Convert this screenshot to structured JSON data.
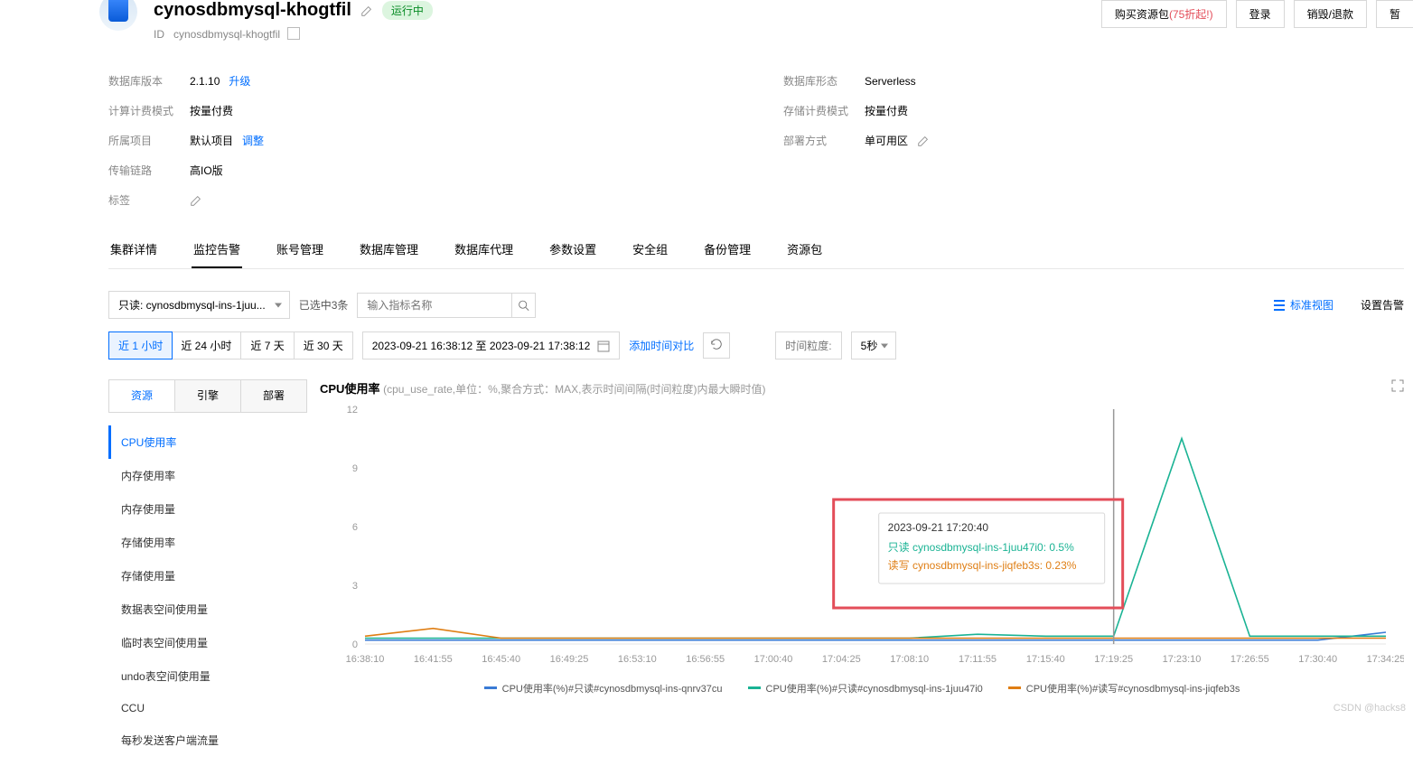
{
  "header": {
    "title": "cynosdbmysql-khogtfil",
    "status_badge": "运行中",
    "id_label": "ID",
    "id_value": "cynosdbmysql-khogtfil",
    "actions": {
      "buy_prefix": "购买资源包",
      "buy_promo": "(75折起!)",
      "login": "登录",
      "destroy": "销毁/退款",
      "pause": "暂"
    }
  },
  "info_left": [
    {
      "label": "数据库版本",
      "value": "2.1.10",
      "link": "升级"
    },
    {
      "label": "计算计费模式",
      "value": "按量付费"
    },
    {
      "label": "所属项目",
      "value": "默认项目",
      "link": "调整"
    },
    {
      "label": "传输链路",
      "value": "高IO版"
    },
    {
      "label": "标签",
      "value": "",
      "pen": true
    }
  ],
  "info_right": [
    {
      "label": "数据库形态",
      "value": "Serverless"
    },
    {
      "label": "存储计费模式",
      "value": "按量付费"
    },
    {
      "label": "部署方式",
      "value": "单可用区",
      "pen": true
    }
  ],
  "tabs": [
    "集群详情",
    "监控告警",
    "账号管理",
    "数据库管理",
    "数据库代理",
    "参数设置",
    "安全组",
    "备份管理",
    "资源包"
  ],
  "tab_active": 1,
  "toolbar": {
    "instance_select": "只读: cynosdbmysql-ins-1juu...",
    "selected_count": "已选中3条",
    "search_placeholder": "输入指标名称",
    "standard_view": "标准视图",
    "set_alarm": "设置告警"
  },
  "timebar": {
    "ranges": [
      "近 1 小时",
      "近 24 小时",
      "近 7 天",
      "近 30 天"
    ],
    "range_active": 0,
    "datetime_range": "2023-09-21 16:38:12 至 2023-09-21 17:38:12",
    "add_compare": "添加时间对比",
    "granularity_label": "时间粒度:",
    "granularity_value": "5秒"
  },
  "metric_panel": {
    "tabs": [
      "资源",
      "引擎",
      "部署"
    ],
    "tab_active": 0,
    "items": [
      "CPU使用率",
      "内存使用率",
      "内存使用量",
      "存储使用率",
      "存储使用量",
      "数据表空间使用量",
      "临时表空间使用量",
      "undo表空间使用量",
      "CCU",
      "每秒发送客户端流量"
    ],
    "item_active": 0
  },
  "chart": {
    "title": "CPU使用率",
    "desc": "(cpu_use_rate,单位：%,聚合方式：MAX,表示时间间隔(时间粒度)内最大瞬时值)",
    "tooltip": {
      "time": "2023-09-21 17:20:40",
      "rows": [
        {
          "color": "#1ab394",
          "text": "只读 cynosdbmysql-ins-1juu47i0: 0.5%"
        },
        {
          "color": "#df7e14",
          "text": "读写 cynosdbmysql-ins-jiqfeb3s: 0.23%"
        }
      ]
    },
    "legend": [
      {
        "color": "#3a7bd5",
        "text": "CPU使用率(%)#只读#cynosdbmysql-ins-qnrv37cu"
      },
      {
        "color": "#1ab394",
        "text": "CPU使用率(%)#只读#cynosdbmysql-ins-1juu47i0"
      },
      {
        "color": "#df7e14",
        "text": "CPU使用率(%)#读写#cynosdbmysql-ins-jiqfeb3s"
      }
    ]
  },
  "chart_data": {
    "type": "line",
    "title": "CPU使用率",
    "ylabel": "%",
    "ylim": [
      0,
      12
    ],
    "yticks": [
      0,
      3,
      6,
      9,
      12
    ],
    "x_labels": [
      "16:38:10",
      "16:41:55",
      "16:45:40",
      "16:49:25",
      "16:53:10",
      "16:56:55",
      "17:00:40",
      "17:04:25",
      "17:08:10",
      "17:11:55",
      "17:15:40",
      "17:19:25",
      "17:23:10",
      "17:26:55",
      "17:30:40",
      "17:34:25"
    ],
    "series": [
      {
        "name": "只读 qnrv37cu",
        "color": "#3a7bd5",
        "values": [
          0.2,
          0.2,
          0.2,
          0.2,
          0.2,
          0.2,
          0.2,
          0.2,
          0.2,
          0.2,
          0.2,
          0.2,
          0.2,
          0.2,
          0.2,
          0.6
        ]
      },
      {
        "name": "只读 1juu47i0",
        "color": "#1ab394",
        "values": [
          0.3,
          0.3,
          0.3,
          0.3,
          0.3,
          0.3,
          0.3,
          0.3,
          0.3,
          0.5,
          0.4,
          0.4,
          10.5,
          0.4,
          0.4,
          0.4
        ]
      },
      {
        "name": "读写 jiqfeb3s",
        "color": "#df7e14",
        "values": [
          0.4,
          0.8,
          0.3,
          0.3,
          0.3,
          0.3,
          0.3,
          0.3,
          0.3,
          0.3,
          0.3,
          0.3,
          0.3,
          0.3,
          0.3,
          0.3
        ]
      }
    ],
    "cursor_index": 11
  },
  "watermark": "CSDN @hacks8"
}
